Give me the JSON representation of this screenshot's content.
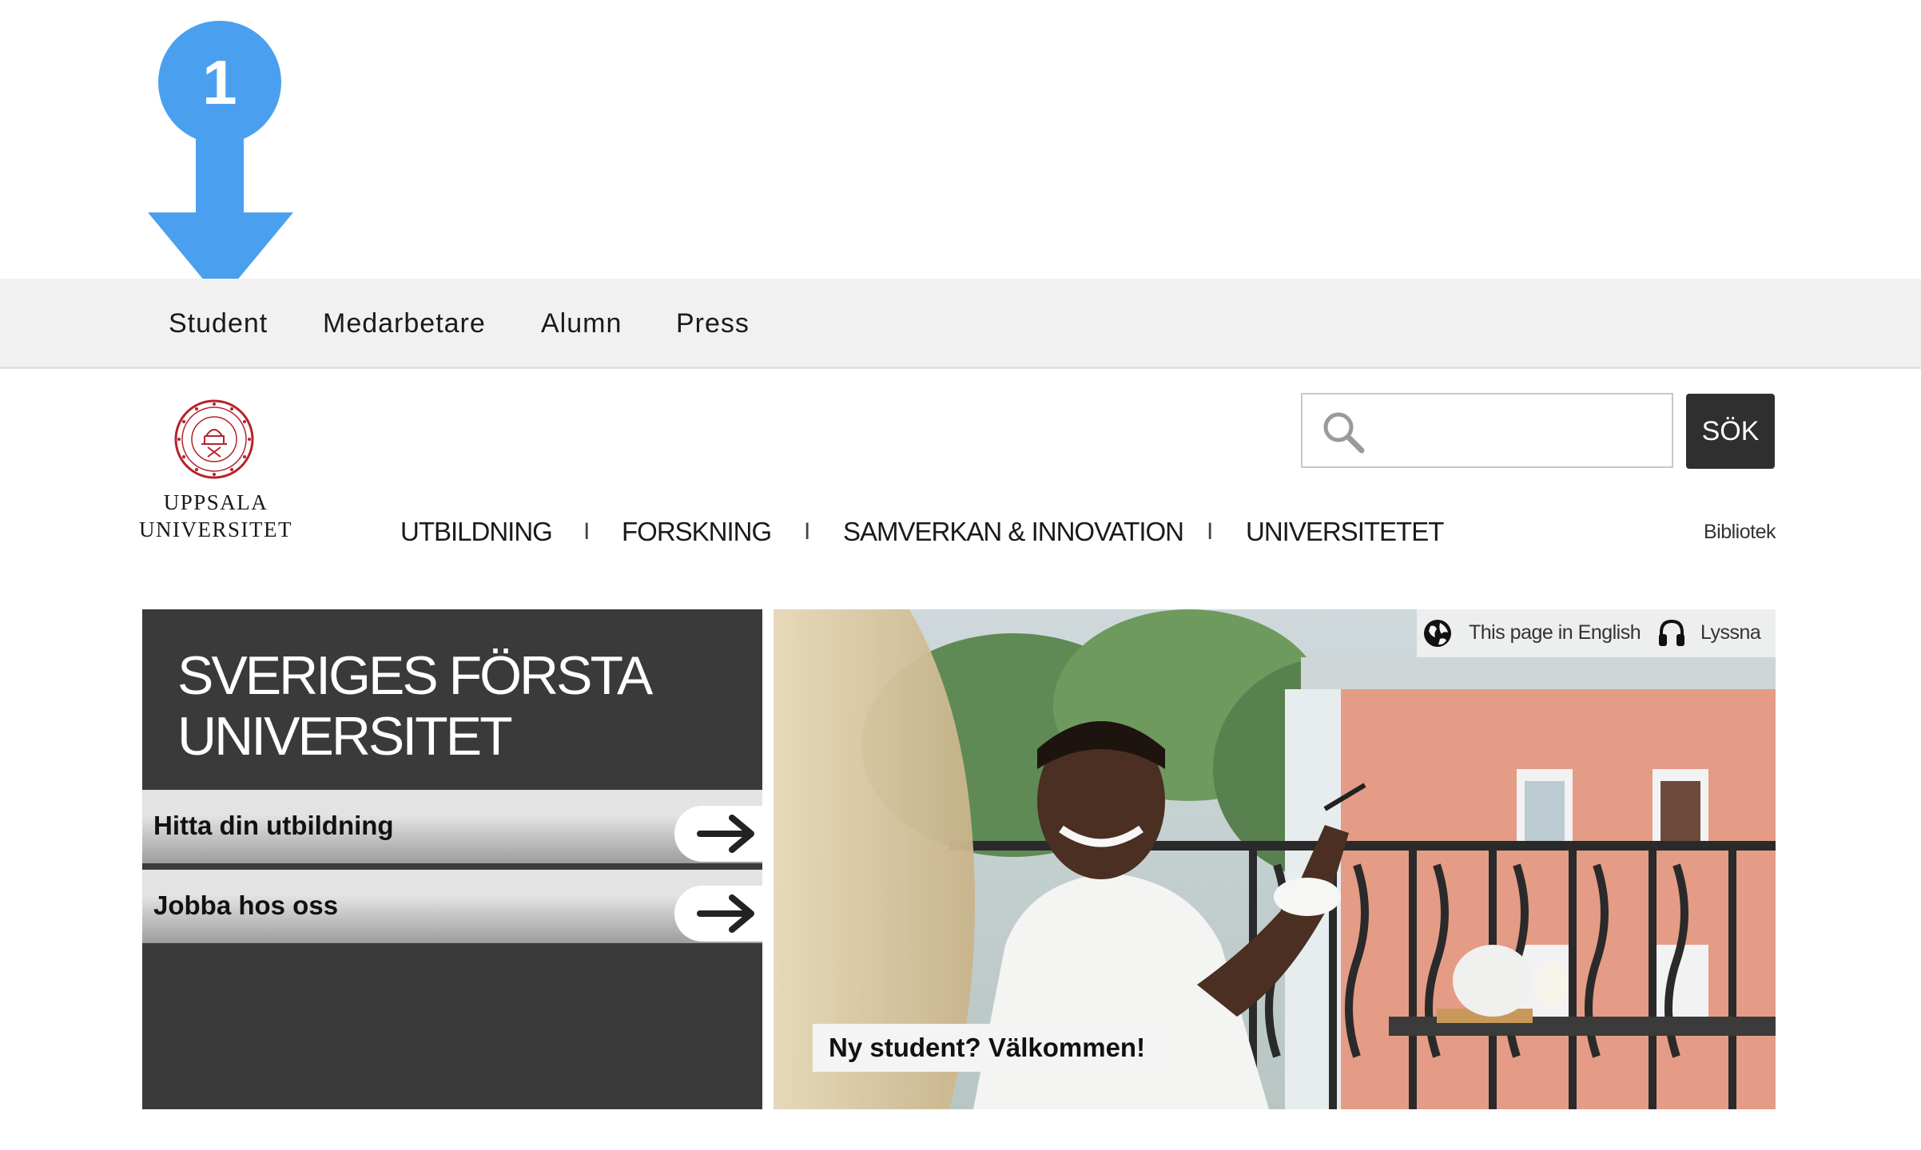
{
  "annotation": {
    "number": "1"
  },
  "audience_nav": [
    {
      "label": "Student"
    },
    {
      "label": "Medarbetare"
    },
    {
      "label": "Alumn"
    },
    {
      "label": "Press"
    }
  ],
  "logo": {
    "line1": "UPPSALA",
    "line2": "UNIVERSITET"
  },
  "search": {
    "value": "",
    "placeholder": "",
    "button_label": "SÖK"
  },
  "main_nav": [
    {
      "label": "UTBILDNING"
    },
    {
      "label": "FORSKNING"
    },
    {
      "label": "SAMVERKAN & INNOVATION"
    },
    {
      "label": "UNIVERSITETET"
    }
  ],
  "separator": "I",
  "bibliotek": "Bibliotek",
  "hero": {
    "title_line1": "SVERIGES FÖRSTA",
    "title_line2": "UNIVERSITET",
    "ctas": [
      {
        "label": "Hitta din utbildning"
      },
      {
        "label": "Jobba hos oss"
      }
    ]
  },
  "photo": {
    "lang_english": "This page in English",
    "listen": "Lyssna",
    "caption": "Ny student? Välkommen!"
  },
  "colors": {
    "accent": "#4aa0ef",
    "dark": "#3a3a3a",
    "brand_red": "#b4232a"
  }
}
